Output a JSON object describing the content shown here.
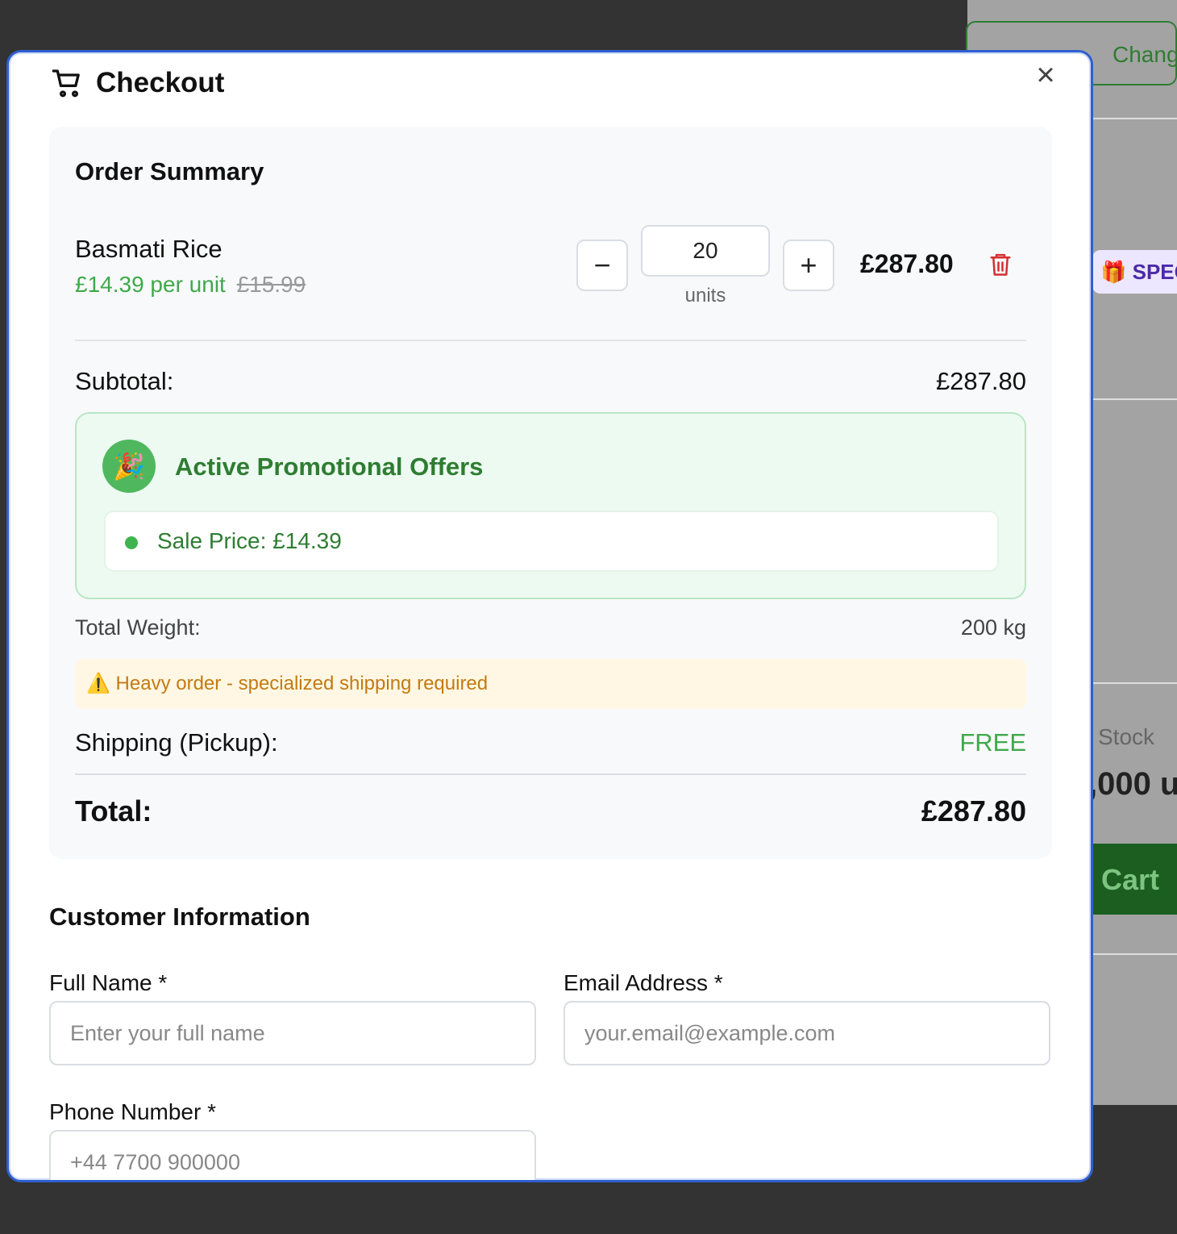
{
  "background": {
    "store_button_label": "Change Store",
    "special_badge": "🎁 SPEC",
    "stock_label": "Stock",
    "stock_value": ",000 u",
    "cart_button_label": "Cart"
  },
  "modal": {
    "title": "Checkout",
    "close_icon": "×"
  },
  "order_summary": {
    "title": "Order Summary",
    "item": {
      "name": "Basmati Rice",
      "unit_price": "£14.39 per unit",
      "original_price": "£15.99",
      "quantity": "20",
      "unit_label": "units",
      "line_total": "£287.80",
      "minus_label": "−",
      "plus_label": "+"
    },
    "subtotal_label": "Subtotal:",
    "subtotal_value": "£287.80",
    "promo": {
      "badge_icon": "🎉",
      "title": "Active Promotional Offers",
      "offers": [
        "Sale Price: £14.39"
      ]
    },
    "weight_label": "Total Weight:",
    "weight_value": "200 kg",
    "warning": "⚠️ Heavy order - specialized shipping required",
    "shipping_label": "Shipping (Pickup):",
    "shipping_value": "FREE",
    "total_label": "Total:",
    "total_value": "£287.80"
  },
  "customer": {
    "title": "Customer Information",
    "full_name_label": "Full Name *",
    "full_name_placeholder": "Enter your full name",
    "email_label": "Email Address *",
    "email_placeholder": "your.email@example.com",
    "phone_label": "Phone Number *",
    "phone_placeholder": "+44 7700 900000"
  },
  "colors": {
    "accent_green": "#3fa94a",
    "modal_border": "#2f5fd0",
    "delete_red": "#d32f2f",
    "warning_text": "#c37a12"
  }
}
